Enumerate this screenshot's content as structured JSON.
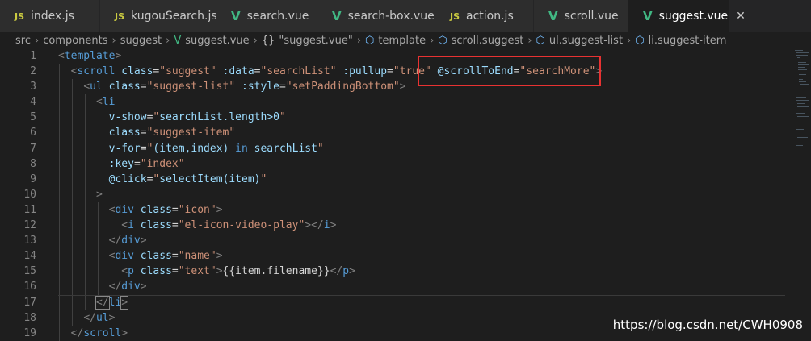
{
  "tabs": [
    {
      "label": "index.js",
      "type": "js",
      "badge": "JS"
    },
    {
      "label": "kugouSearch.js",
      "type": "js",
      "badge": "JS"
    },
    {
      "label": "search.vue",
      "type": "vue",
      "badge": "V"
    },
    {
      "label": "search-box.vue",
      "type": "vue",
      "badge": "V"
    },
    {
      "label": "action.js",
      "type": "js",
      "badge": "JS"
    },
    {
      "label": "scroll.vue",
      "type": "vue",
      "badge": "V"
    },
    {
      "label": "suggest.vue",
      "type": "vue",
      "badge": "V",
      "active": true
    }
  ],
  "close_glyph": "✕",
  "breadcrumb": {
    "seg1": "src",
    "seg2": "components",
    "seg3": "suggest",
    "seg4": "suggest.vue",
    "seg5": "\"suggest.vue\"",
    "seg6": "template",
    "seg7": "scroll.suggest",
    "seg8": "ul.suggest-list",
    "seg9": "li.suggest-item",
    "brace_glyph": "{}",
    "vue_icon": "V",
    "cube_icon": "⬡",
    "separator": "›"
  },
  "line_numbers": [
    "1",
    "2",
    "3",
    "4",
    "5",
    "6",
    "7",
    "8",
    "9",
    "10",
    "11",
    "12",
    "13",
    "14",
    "15",
    "16",
    "17",
    "18",
    "19"
  ],
  "code": {
    "l1": {
      "open": "<",
      "tag": "template",
      "close": ">"
    },
    "l2": {
      "open": "<",
      "tag": "scroll",
      "a1": "class",
      "v1": "\"suggest\"",
      "a2": ":data",
      "v2": "\"searchList\"",
      "a3": ":pullup",
      "v3": "\"true\"",
      "a4": "@scrollToEnd",
      "v4": "\"searchMore\"",
      "close": ">",
      "eq": "="
    },
    "l3": {
      "open": "<",
      "tag": "ul",
      "a1": "class",
      "v1": "\"suggest-list\"",
      "a2": ":style",
      "v2": "\"setPaddingBottom\"",
      "close": ">",
      "eq": "="
    },
    "l4": {
      "open": "<",
      "tag": "li"
    },
    "l5": {
      "attr": "v-show",
      "eq": "=",
      "q1": "\"",
      "expr": "searchList.length>0",
      "q2": "\""
    },
    "l6": {
      "attr": "class",
      "eq": "=",
      "val": "\"suggest-item\""
    },
    "l7": {
      "attr": "v-for",
      "eq": "=",
      "q1": "\"",
      "expr": "(item,index) ",
      "kw": "in",
      "expr2": " searchList",
      "q2": "\""
    },
    "l8": {
      "attr": ":key",
      "eq": "=",
      "val": "\"index\""
    },
    "l9": {
      "attr": "@click",
      "eq": "=",
      "q1": "\"",
      "expr": "selectItem(item)",
      "q2": "\""
    },
    "l10": {
      "close": ">"
    },
    "l11": {
      "open": "<",
      "tag": "div",
      "a1": "class",
      "eq": "=",
      "v1": "\"icon\"",
      "close": ">"
    },
    "l12": {
      "open": "<",
      "tag": "i",
      "a1": "class",
      "eq": "=",
      "v1": "\"el-icon-video-play\"",
      "close": ">",
      "endopen": "</",
      "endtag": "i",
      "endclose": ">"
    },
    "l13": {
      "endopen": "</",
      "endtag": "div",
      "endclose": ">"
    },
    "l14": {
      "open": "<",
      "tag": "div",
      "a1": "class",
      "eq": "=",
      "v1": "\"name\"",
      "close": ">"
    },
    "l15": {
      "open": "<",
      "tag": "p",
      "a1": "class",
      "eq": "=",
      "v1": "\"text\"",
      "close": ">",
      "text": "{{item.filename}}",
      "endopen": "</",
      "endtag": "p",
      "endclose": ">"
    },
    "l16": {
      "endopen": "</",
      "endtag": "div",
      "endclose": ">"
    },
    "l17": {
      "endopen": "</",
      "endtag": "li",
      "endclose": ">"
    },
    "l18": {
      "endopen": "</",
      "endtag": "ul",
      "endclose": ">"
    },
    "l19": {
      "endopen": "</",
      "endtag": "scroll",
      "endclose": ">"
    }
  },
  "watermark": "https://blog.csdn.net/CWH0908",
  "colors": {
    "tag": "#569cd6",
    "attr": "#9cdcfe",
    "string": "#ce9178",
    "punct": "#808080",
    "highlight_box": "#e83232",
    "vue": "#41b883",
    "js": "#cbcb41"
  }
}
